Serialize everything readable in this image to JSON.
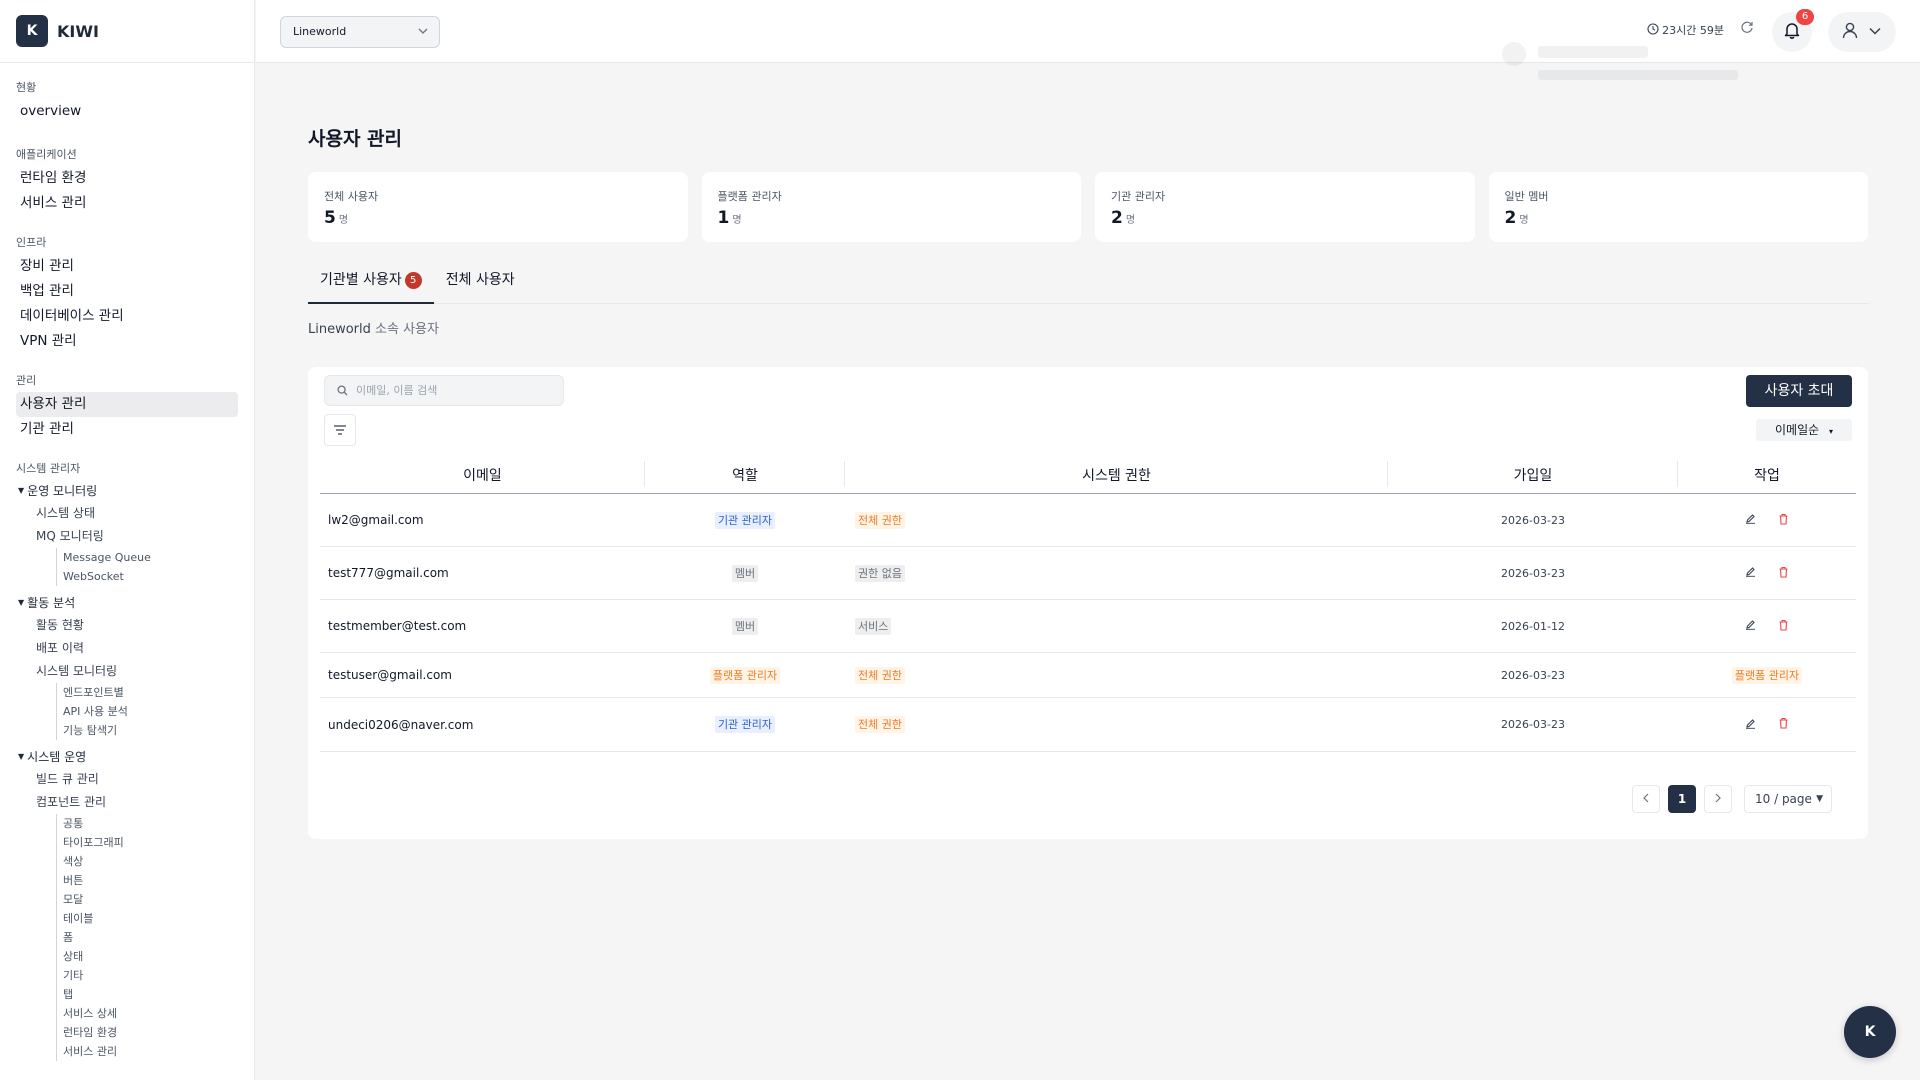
{
  "brand": {
    "logo_letter": "K",
    "name": "KIWI"
  },
  "sidebar": {
    "sections": [
      {
        "title": "현황",
        "items": [
          "overview"
        ]
      },
      {
        "title": "애플리케이션",
        "items": [
          "런타임 환경",
          "서비스 관리"
        ]
      },
      {
        "title": "인프라",
        "items": [
          "장비 관리",
          "백업 관리",
          "데이터베이스 관리",
          "VPN 관리"
        ]
      },
      {
        "title": "관리",
        "items": [
          "사용자 관리",
          "기관 관리"
        ],
        "active": "사용자 관리"
      },
      {
        "title": "시스템 관리자"
      }
    ],
    "groups": {
      "ops_monitoring": {
        "label": "운영 모니터링",
        "items": [
          "시스템 상태",
          "MQ 모니터링"
        ],
        "mq_children": [
          "Message Queue",
          "WebSocket"
        ]
      },
      "activity": {
        "label": "활동 분석",
        "items": [
          "활동 현황",
          "배포 이력",
          "시스템 모니터링"
        ],
        "sysmon_children": [
          "엔드포인트별",
          "API 사용 분석",
          "기능 탐색기"
        ]
      },
      "system_ops": {
        "label": "시스템 운영",
        "items": [
          "빌드 큐 관리",
          "컴포넌트 관리"
        ],
        "component_children": [
          "공통",
          "타이포그래피",
          "색상",
          "버튼",
          "모달",
          "테이블",
          "폼",
          "상태",
          "기타",
          "탭",
          "서비스 상세",
          "런타임 환경",
          "서비스 관리"
        ]
      }
    }
  },
  "header": {
    "org_select": "Lineworld",
    "session_time": "23시간 59분",
    "notification_count": "6"
  },
  "page": {
    "title": "사용자 관리",
    "stats": [
      {
        "label": "전체 사용자",
        "value": "5",
        "unit": "명"
      },
      {
        "label": "플랫폼 관리자",
        "value": "1",
        "unit": "명"
      },
      {
        "label": "기관 관리자",
        "value": "2",
        "unit": "명"
      },
      {
        "label": "일반 멤버",
        "value": "2",
        "unit": "명"
      }
    ],
    "tabs": [
      {
        "label": "기관별 사용자",
        "badge": "5"
      },
      {
        "label": "전체 사용자"
      }
    ],
    "subtitle_org": "Lineworld",
    "subtitle_rest": "소속 사용자"
  },
  "table": {
    "search_placeholder": "이메일, 이름 검색",
    "invite_label": "사용자 초대",
    "sort_label": "이메일순",
    "columns": [
      "이메일",
      "역할",
      "시스템 권한",
      "가입일",
      "작업"
    ],
    "rows": [
      {
        "email": "lw2@gmail.com",
        "role": "기관 관리자",
        "perm": "전체 권한",
        "joined": "2026-03-23",
        "action": ""
      },
      {
        "email": "test777@gmail.com",
        "role": "멤버",
        "perm": "권한 없음",
        "joined": "2026-03-23",
        "action": ""
      },
      {
        "email": "testmember@test.com",
        "role": "멤버",
        "perm": "서비스",
        "joined": "2026-01-12",
        "action": ""
      },
      {
        "email": "testuser@gmail.com",
        "role": "플랫폼 관리자",
        "perm": "전체 권한",
        "joined": "2026-03-23",
        "action": "플랫폼 관리자"
      },
      {
        "email": "undeci0206@naver.com",
        "role": "기관 관리자",
        "perm": "전체 권한",
        "joined": "2026-03-23",
        "action": ""
      }
    ]
  },
  "pagination": {
    "current": "1",
    "per_page": "10 / page"
  },
  "fab_letter": "K",
  "colors": {
    "primary": "#233045",
    "badge_red": "#ef4444",
    "tag_blue": "#2f5fd0",
    "tag_orange": "#ee7d28"
  }
}
